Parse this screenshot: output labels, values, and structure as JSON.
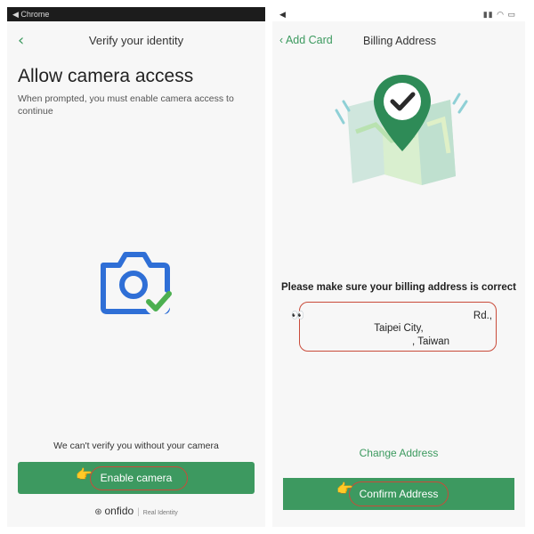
{
  "left": {
    "status_text": "◀ Chrome",
    "nav_title": "Verify your identity",
    "back_glyph": "‹",
    "heading": "Allow camera access",
    "subtitle": "When prompted, you must enable camera access to continue",
    "icon": "camera-check-icon",
    "warning": "We can't verify you without your camera",
    "button_label": "Enable camera",
    "brand": "onfido",
    "brand_tag": "Real Identity"
  },
  "right": {
    "status_text": "◀",
    "nav_back": "‹ Add Card",
    "nav_title": "Billing Address",
    "illustration": "map-pin-check-icon",
    "confirm_text": "Please make sure your billing address is correct",
    "address_line1": "Rd.,",
    "address_line2": "Taipei City,",
    "address_line3": ", Taiwan",
    "change_link": "Change Address",
    "button_label": "Confirm Address"
  },
  "colors": {
    "accent_green": "#3d9960",
    "camera_blue": "#2f6fd6",
    "check_green": "#4caf50",
    "annotation_red": "#c94b3a"
  }
}
